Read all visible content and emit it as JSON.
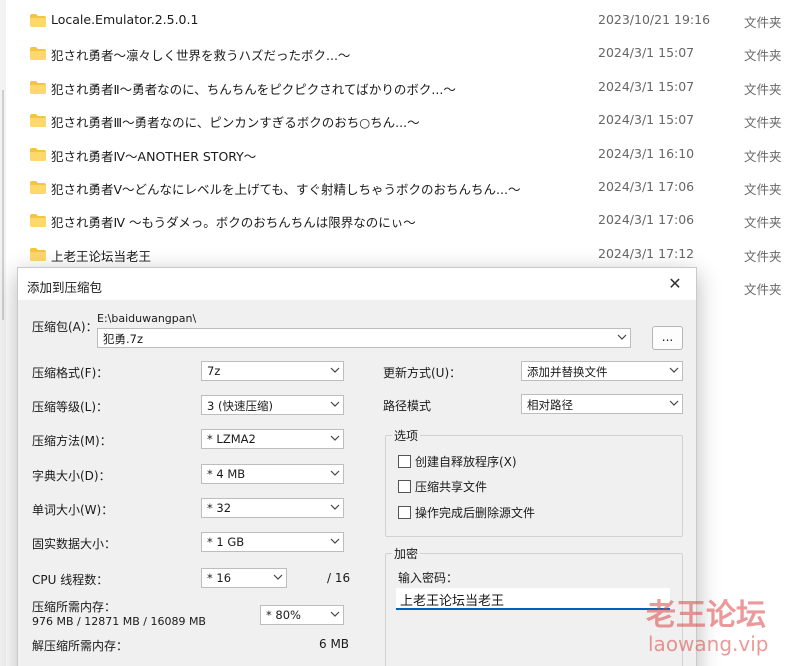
{
  "explorer": {
    "files": [
      {
        "name": "Locale.Emulator.2.5.0.1",
        "date": "2023/10/21 19:16",
        "type": "文件夹"
      },
      {
        "name": "犯され勇者～凛々しく世界を救うハズだったボク...～",
        "date": "2024/3/1 15:07",
        "type": "文件夹"
      },
      {
        "name": "犯され勇者Ⅱ～勇者なのに、ちんちんをピクピクされてばかりのボク...～",
        "date": "2024/3/1 15:07",
        "type": "文件夹"
      },
      {
        "name": "犯され勇者Ⅲ～勇者なのに、ピンカンすぎるボクのおち○ちん...～",
        "date": "2024/3/1 15:07",
        "type": "文件夹"
      },
      {
        "name": "犯され勇者Ⅳ～ANOTHER STORY～",
        "date": "2024/3/1 16:10",
        "type": "文件夹"
      },
      {
        "name": "犯され勇者Ⅴ～どんなにレベルを上げても、すぐ射精しちゃうボクのおちんちん...～",
        "date": "2024/3/1 17:06",
        "type": "文件夹"
      },
      {
        "name": "犯され勇者Ⅳ ～もうダメっ。ボクのおちんちんは限界なのにぃ～",
        "date": "2024/3/1 17:06",
        "type": "文件夹"
      },
      {
        "name": "上老王论坛当老王",
        "date": "2024/3/1 17:12",
        "type": "文件夹"
      },
      {
        "name": "",
        "date": "",
        "type": "文件夹"
      }
    ],
    "folder_color": "#f4c542"
  },
  "dialog": {
    "title": "添加到压缩包",
    "close_glyph": "✕",
    "archive_label": "压缩包(A)：",
    "archive_path": "E:\\baiduwangpan\\",
    "archive_name": "犯勇.7z",
    "browse_label": "...",
    "left": [
      {
        "label": "压缩格式(F)：",
        "value": "7z"
      },
      {
        "label": "压缩等级(L)：",
        "value": "3 (快速压缩)"
      },
      {
        "label": "压缩方法(M)：",
        "value": "* LZMA2"
      },
      {
        "label": "字典大小(D)：",
        "value": "* 4 MB"
      },
      {
        "label": "单词大小(W)：",
        "value": "* 32"
      },
      {
        "label": "固实数据大小：",
        "value": "* 1 GB"
      }
    ],
    "cpu_label": "CPU 线程数：",
    "cpu_value": "* 16",
    "cpu_total": "/ 16",
    "mem_compress_label": "压缩所需内存：",
    "mem_compress_detail": "976 MB / 12871 MB / 16089 MB",
    "mem_compress_value": "* 80%",
    "mem_decompress_label": "解压缩所需内存：",
    "mem_decompress_value": "6 MB",
    "update_label": "更新方式(U)：",
    "update_value": "添加并替换文件",
    "path_label": "路径模式",
    "path_value": "相对路径",
    "options_title": "选项",
    "options": [
      "创建自释放程序(X)",
      "压缩共享文件",
      "操作完成后删除源文件"
    ],
    "encrypt_title": "加密",
    "password_label": "输入密码：",
    "password_value": "上老王论坛当老王"
  },
  "watermark": {
    "line1": "老王论坛",
    "line2": "laowang.vip"
  }
}
